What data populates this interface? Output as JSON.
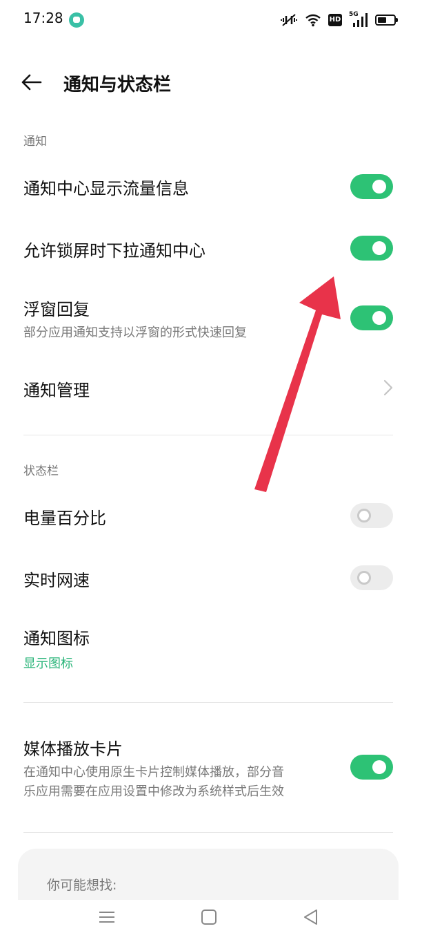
{
  "status_bar": {
    "time": "17:28",
    "hd_label": "HD",
    "network_label": "5G",
    "icons": [
      "message-bubble-icon",
      "mute-vibrate-icon",
      "wifi-icon",
      "hd-icon",
      "5g-signal-icon",
      "battery-icon"
    ]
  },
  "header": {
    "title": "通知与状态栏",
    "back_icon": "back-arrow-icon"
  },
  "sections": {
    "notification": {
      "label": "通知",
      "rows": {
        "traffic_info": {
          "title": "通知中心显示流量信息",
          "enabled": true
        },
        "lockscreen_pull": {
          "title": "允许锁屏时下拉通知中心",
          "enabled": true
        },
        "floating_reply": {
          "title": "浮窗回复",
          "desc": "部分应用通知支持以浮窗的形式快速回复",
          "enabled": true
        },
        "notification_manage": {
          "title": "通知管理"
        }
      }
    },
    "status_bar": {
      "label": "状态栏",
      "rows": {
        "battery_percent": {
          "title": "电量百分比",
          "enabled": false
        },
        "realtime_speed": {
          "title": "实时网速",
          "enabled": false
        },
        "notification_icon": {
          "title": "通知图标",
          "value": "显示图标"
        }
      }
    },
    "media": {
      "rows": {
        "media_card": {
          "title": "媒体播放卡片",
          "desc_line1": "在通知中心使用原生卡片控制媒体播放，部分音",
          "desc_line2": "乐应用需要在应用设置中修改为系统样式后生效",
          "enabled": true
        }
      }
    }
  },
  "suggest": {
    "title": "你可能想找:"
  },
  "nav_bar": {
    "icons": [
      "menu-icon",
      "home-square-icon",
      "back-triangle-icon"
    ]
  },
  "colors": {
    "accent_green": "#2dc275",
    "toggle_off": "#ececec",
    "annotation_red": "#e8334a",
    "sub_accent": "#2bb57a"
  }
}
